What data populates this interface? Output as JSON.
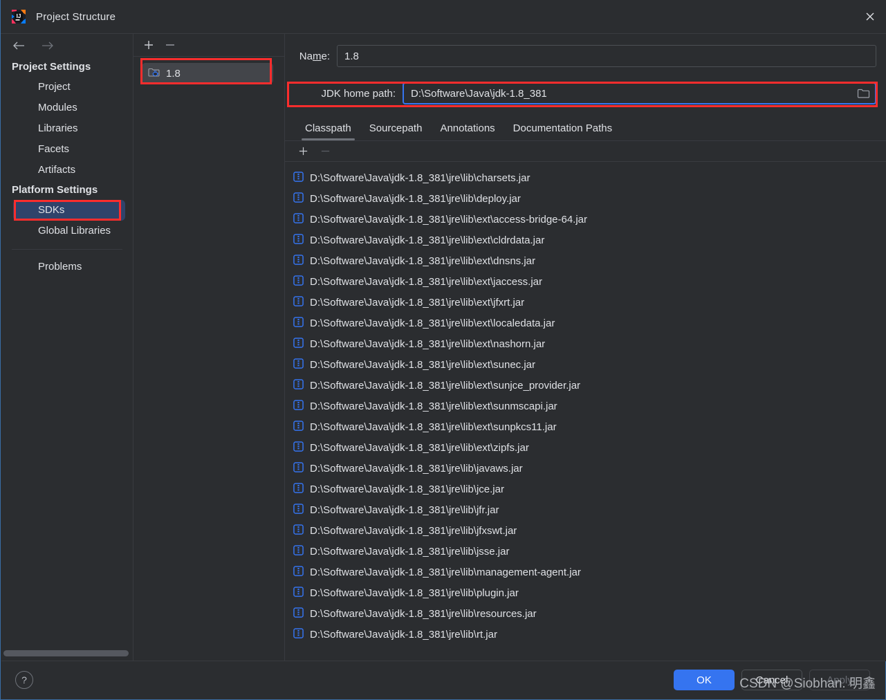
{
  "window": {
    "title": "Project Structure",
    "app_icon": "intellij-idea-logo",
    "close_icon": "close-icon"
  },
  "sidebar": {
    "back_icon": "arrow-left-icon",
    "forward_icon": "arrow-right-icon",
    "groups": [
      {
        "header": "Project Settings",
        "items": [
          {
            "label": "Project",
            "selected": false
          },
          {
            "label": "Modules",
            "selected": false
          },
          {
            "label": "Libraries",
            "selected": false
          },
          {
            "label": "Facets",
            "selected": false
          },
          {
            "label": "Artifacts",
            "selected": false
          }
        ]
      },
      {
        "header": "Platform Settings",
        "items": [
          {
            "label": "SDKs",
            "selected": true
          },
          {
            "label": "Global Libraries",
            "selected": false
          }
        ]
      }
    ],
    "extra_items": [
      {
        "label": "Problems",
        "selected": false
      }
    ]
  },
  "sdk_panel": {
    "add_icon": "plus-icon",
    "remove_icon": "minus-icon",
    "items": [
      {
        "label": "1.8",
        "icon": "jdk-folder-icon",
        "selected": true
      }
    ]
  },
  "detail": {
    "name_label": "Name:",
    "name_value": "1.8",
    "jdk_home_label": "JDK home path:",
    "jdk_home_value": "D:\\Software\\Java\\jdk-1.8_381",
    "browse_icon": "folder-icon",
    "tabs": [
      {
        "label": "Classpath",
        "active": true
      },
      {
        "label": "Sourcepath",
        "active": false
      },
      {
        "label": "Annotations",
        "active": false
      },
      {
        "label": "Documentation Paths",
        "active": false
      }
    ],
    "list_toolbar": {
      "add_icon": "plus-icon",
      "remove_icon": "minus-icon"
    },
    "classpath_entries": [
      "D:\\Software\\Java\\jdk-1.8_381\\jre\\lib\\charsets.jar",
      "D:\\Software\\Java\\jdk-1.8_381\\jre\\lib\\deploy.jar",
      "D:\\Software\\Java\\jdk-1.8_381\\jre\\lib\\ext\\access-bridge-64.jar",
      "D:\\Software\\Java\\jdk-1.8_381\\jre\\lib\\ext\\cldrdata.jar",
      "D:\\Software\\Java\\jdk-1.8_381\\jre\\lib\\ext\\dnsns.jar",
      "D:\\Software\\Java\\jdk-1.8_381\\jre\\lib\\ext\\jaccess.jar",
      "D:\\Software\\Java\\jdk-1.8_381\\jre\\lib\\ext\\jfxrt.jar",
      "D:\\Software\\Java\\jdk-1.8_381\\jre\\lib\\ext\\localedata.jar",
      "D:\\Software\\Java\\jdk-1.8_381\\jre\\lib\\ext\\nashorn.jar",
      "D:\\Software\\Java\\jdk-1.8_381\\jre\\lib\\ext\\sunec.jar",
      "D:\\Software\\Java\\jdk-1.8_381\\jre\\lib\\ext\\sunjce_provider.jar",
      "D:\\Software\\Java\\jdk-1.8_381\\jre\\lib\\ext\\sunmscapi.jar",
      "D:\\Software\\Java\\jdk-1.8_381\\jre\\lib\\ext\\sunpkcs11.jar",
      "D:\\Software\\Java\\jdk-1.8_381\\jre\\lib\\ext\\zipfs.jar",
      "D:\\Software\\Java\\jdk-1.8_381\\jre\\lib\\javaws.jar",
      "D:\\Software\\Java\\jdk-1.8_381\\jre\\lib\\jce.jar",
      "D:\\Software\\Java\\jdk-1.8_381\\jre\\lib\\jfr.jar",
      "D:\\Software\\Java\\jdk-1.8_381\\jre\\lib\\jfxswt.jar",
      "D:\\Software\\Java\\jdk-1.8_381\\jre\\lib\\jsse.jar",
      "D:\\Software\\Java\\jdk-1.8_381\\jre\\lib\\management-agent.jar",
      "D:\\Software\\Java\\jdk-1.8_381\\jre\\lib\\plugin.jar",
      "D:\\Software\\Java\\jdk-1.8_381\\jre\\lib\\resources.jar",
      "D:\\Software\\Java\\jdk-1.8_381\\jre\\lib\\rt.jar"
    ],
    "entry_icon": "jar-archive-icon"
  },
  "footer": {
    "help_label": "?",
    "ok_label": "OK",
    "cancel_label": "Cancel",
    "apply_label": "Apply"
  },
  "watermark": "CSDN @Siobhan. 明鑫",
  "colors": {
    "accent": "#3574f0",
    "annotation": "#fc2d2d",
    "selection": "#2f436a",
    "background": "#2b2d30",
    "text": "#dfe1e5"
  }
}
